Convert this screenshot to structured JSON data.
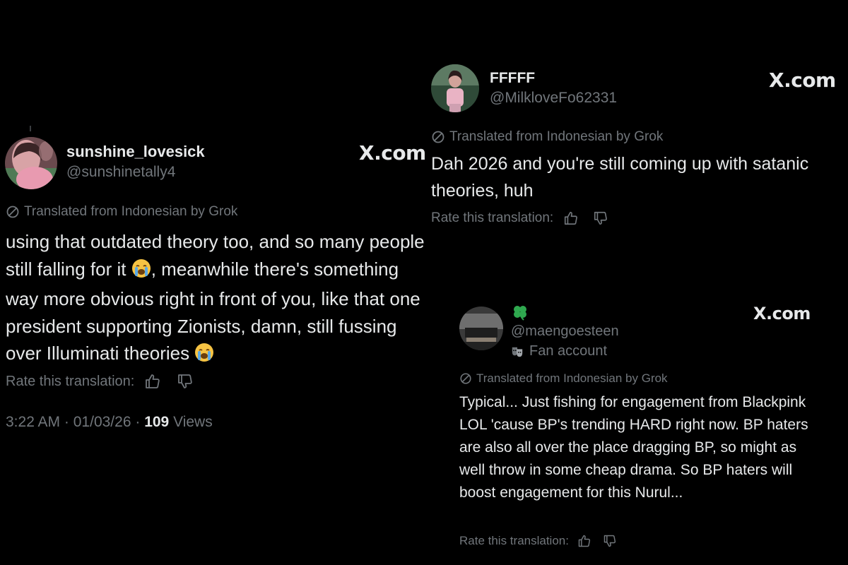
{
  "post1": {
    "display_name": "sunshine_lovesick",
    "handle": "@sunshinetally4",
    "site_mark": "X.com",
    "translated_label": "Translated from Indonesian by Grok",
    "text_part1": "using that outdated theory too, and so many people still falling for it",
    "text_part2": ", meanwhile there's something way more obvious right in front of you, like that one president supporting Zionists, damn, still fussing over Illuminati theories",
    "emoji": "loudly-crying-face",
    "rate_label": "Rate this translation:",
    "time": "3:22 AM",
    "date": "01/03/26",
    "separator": "·",
    "views_count": "109",
    "views_label": "Views"
  },
  "post2": {
    "display_name": "FFFFF",
    "handle": "@MilkloveFo62331",
    "site_mark": "X.com",
    "translated_label": "Translated from Indonesian by Grok",
    "text": "Dah 2026 and you're still coming up with satanic theories, huh",
    "rate_label": "Rate this translation:"
  },
  "post3": {
    "display_name_icon": "four-leaf-clover",
    "handle": "@maengoesteen",
    "badge_label": "Fan account",
    "site_mark": "X.com",
    "translated_label": "Translated from Indonesian by Grok",
    "text": "Typical... Just fishing for engagement from Blackpink LOL 'cause BP's trending HARD right now. BP haters are also all over the place dragging BP, so might as well throw in some cheap drama. So BP haters will boost engagement for this Nurul...",
    "rate_label": "Rate this translation:"
  },
  "colors": {
    "background": "#000000",
    "text": "#e7e9ea",
    "muted": "#71767b",
    "avatar_accent": "#e89ab0"
  }
}
